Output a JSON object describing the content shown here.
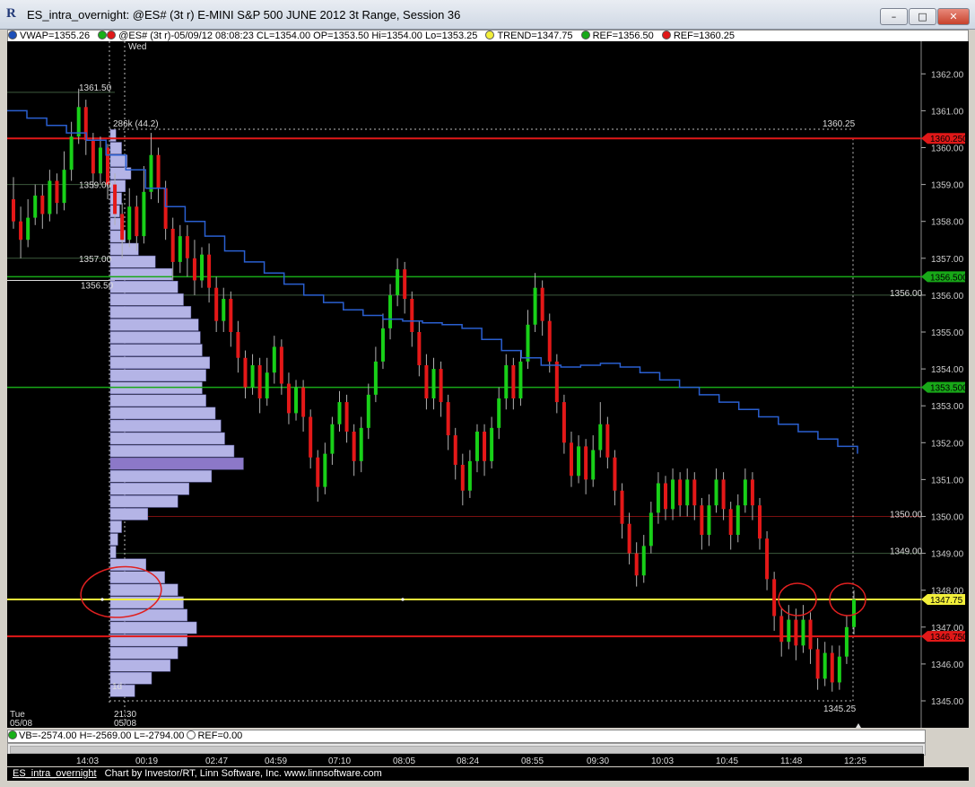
{
  "window": {
    "title": "ES_intra_overnight: @ES# (3t r) E-MINI S&P 500 JUNE 2012 3t Range, Session 36",
    "icon": "R",
    "minimize": "–",
    "maximize": "□",
    "close": "✕"
  },
  "infobar": {
    "vwap": "VWAP=1355.26",
    "quote": "@ES# (3t r)-05/09/12 08:08:23 CL=1354.00 OP=1353.50 Hi=1354.00 Lo=1353.25",
    "trend": "TREND=1347.75",
    "ref1": "REF=1356.50",
    "ref2": "REF=1360.25",
    "colors": {
      "vwap": "#1d4fb8",
      "trend": "#f2ef3a",
      "ref_green": "#18a818",
      "ref_red": "#e01818"
    }
  },
  "mbox": "M",
  "bottombar": {
    "vb": "VB=-2574.00 H=-2569.00 L=-2794.00",
    "ref": "REF=0.00"
  },
  "status": {
    "tab": "ES_intra_overnight",
    "credit": "Chart by Investor/RT, Linn Software, Inc. www.linnsoftware.com"
  },
  "chart_data": {
    "type": "candlestick",
    "ylim": [
      1343.7,
      1362.5
    ],
    "y_ticks": [
      1344,
      1345,
      1346,
      1347,
      1348,
      1349,
      1350,
      1351,
      1352,
      1353,
      1354,
      1355,
      1356,
      1357,
      1358,
      1359,
      1360,
      1361,
      1362
    ],
    "y_tick_labels": [
      "1344.00",
      "1345.00",
      "1346.00",
      "1347.00",
      "1348.00",
      "1349.00",
      "1350.00",
      "1351.00",
      "1352.00",
      "1353.00",
      "1354.00",
      "1355.00",
      "1356.00",
      "1357.00",
      "1358.00",
      "1359.00",
      "1360.00",
      "1361.00",
      "1362.00"
    ],
    "x_labels": [
      "14:03",
      "00:19",
      "02:47",
      "04:59",
      "07:10",
      "08:05",
      "08:24",
      "08:55",
      "09:30",
      "10:03",
      "10:45",
      "11:48",
      "12:25"
    ],
    "session_labels": {
      "left_day": "Tue",
      "left_date": "05/08",
      "mid_time": "21:30",
      "mid_date": "05/08",
      "day_marker": "Wed",
      "profile_tag": "1d"
    },
    "reference_lines": [
      {
        "name": "REF red upper",
        "value": 1360.25,
        "color": "#e01818",
        "tag": "1360.250"
      },
      {
        "name": "REF green",
        "value": 1356.5,
        "color": "#18a818",
        "tag": "1356.500"
      },
      {
        "name": "green level",
        "value": 1353.5,
        "color": "#18a818",
        "tag": "1353.500"
      },
      {
        "name": "TREND",
        "value": 1347.75,
        "color": "#f2ef3a",
        "tag": "1347.75"
      },
      {
        "name": "REF red lower",
        "value": 1346.75,
        "color": "#e01818",
        "tag": "1346.750"
      }
    ],
    "annotations": [
      {
        "text": "1361.50",
        "value": 1361.5
      },
      {
        "text": "1359.00",
        "value": 1359.0
      },
      {
        "text": "1357.00",
        "value": 1357.0
      },
      {
        "text": "1356.50",
        "value": 1356.5
      },
      {
        "text": "286k (44.2)",
        "value": 1360.5
      },
      {
        "text": "1360.25",
        "value": 1360.5
      },
      {
        "text": "1356.00",
        "value": 1356.0
      },
      {
        "text": "1350.00",
        "value": 1350.0
      },
      {
        "text": "1349.00",
        "value": 1349.0
      },
      {
        "text": "1345.25",
        "value": 1345.0
      }
    ],
    "vwap": [
      1361.0,
      1360.8,
      1360.6,
      1360.4,
      1360.2,
      1359.8,
      1359.4,
      1358.9,
      1358.4,
      1358.0,
      1357.6,
      1357.2,
      1356.9,
      1356.6,
      1356.3,
      1356.0,
      1355.8,
      1355.6,
      1355.45,
      1355.35,
      1355.3,
      1355.25,
      1355.2,
      1355.1,
      1354.8,
      1354.5,
      1354.3,
      1354.1,
      1354.05,
      1354.1,
      1354.15,
      1354.05,
      1353.9,
      1353.7,
      1353.5,
      1353.3,
      1353.1,
      1352.9,
      1352.7,
      1352.5,
      1352.3,
      1352.1,
      1351.9,
      1351.7
    ],
    "profile_volume": [
      0.3,
      0.6,
      0.9,
      1.1,
      0.8,
      0.6,
      0.5,
      0.55,
      0.8,
      1.5,
      2.4,
      3.3,
      3.6,
      3.9,
      4.3,
      4.7,
      4.8,
      4.9,
      5.3,
      5.1,
      4.9,
      5.1,
      5.6,
      5.9,
      6.1,
      6.6,
      7.1,
      5.4,
      4.2,
      3.6,
      2.0,
      0.6,
      0.4,
      0.3,
      1.9,
      2.9,
      3.6,
      3.9,
      4.1,
      4.6,
      4.1,
      3.6,
      3.2,
      2.2,
      1.3
    ],
    "candles": [
      [
        1358.6,
        1358.0,
        1359.2,
        1357.8
      ],
      [
        1358.0,
        1357.5,
        1358.4,
        1357.0
      ],
      [
        1357.5,
        1358.1,
        1358.6,
        1357.3
      ],
      [
        1358.1,
        1358.7,
        1359.0,
        1357.9
      ],
      [
        1358.7,
        1358.2,
        1359.0,
        1357.8
      ],
      [
        1358.2,
        1359.1,
        1359.4,
        1358.0
      ],
      [
        1359.1,
        1358.5,
        1359.3,
        1358.2
      ],
      [
        1358.5,
        1359.4,
        1359.9,
        1358.3
      ],
      [
        1359.4,
        1360.3,
        1360.7,
        1359.1
      ],
      [
        1360.3,
        1361.1,
        1361.6,
        1360.1
      ],
      [
        1361.1,
        1360.2,
        1361.3,
        1359.8
      ],
      [
        1360.2,
        1359.3,
        1360.4,
        1358.9
      ],
      [
        1359.3,
        1360.0,
        1360.3,
        1359.0
      ],
      [
        1360.0,
        1359.0,
        1360.1,
        1358.6
      ],
      [
        1359.0,
        1358.2,
        1359.3,
        1357.9
      ],
      [
        1358.2,
        1357.5,
        1358.5,
        1357.0
      ],
      [
        1357.5,
        1358.4,
        1358.9,
        1357.3
      ],
      [
        1358.4,
        1357.6,
        1358.7,
        1357.2
      ],
      [
        1357.6,
        1358.8,
        1359.5,
        1357.4
      ],
      [
        1358.8,
        1359.8,
        1360.4,
        1358.6
      ],
      [
        1359.8,
        1358.9,
        1360.0,
        1358.5
      ],
      [
        1358.9,
        1357.8,
        1359.1,
        1357.5
      ],
      [
        1357.8,
        1356.9,
        1358.1,
        1356.4
      ],
      [
        1356.9,
        1357.6,
        1357.9,
        1356.6
      ],
      [
        1357.6,
        1357.0,
        1357.9,
        1356.5
      ],
      [
        1357.0,
        1356.4,
        1357.5,
        1356.0
      ],
      [
        1356.4,
        1357.1,
        1357.3,
        1356.2
      ],
      [
        1357.1,
        1356.2,
        1357.4,
        1355.8
      ],
      [
        1356.2,
        1355.3,
        1356.5,
        1355.0
      ],
      [
        1355.3,
        1355.9,
        1356.2,
        1355.0
      ],
      [
        1355.9,
        1355.0,
        1356.1,
        1354.6
      ],
      [
        1355.0,
        1354.3,
        1355.3,
        1353.9
      ],
      [
        1354.3,
        1353.5,
        1354.5,
        1353.2
      ],
      [
        1353.5,
        1354.1,
        1354.4,
        1353.3
      ],
      [
        1354.1,
        1353.2,
        1354.3,
        1352.8
      ],
      [
        1353.2,
        1353.9,
        1354.3,
        1353.0
      ],
      [
        1353.9,
        1354.6,
        1354.9,
        1353.6
      ],
      [
        1354.6,
        1353.6,
        1354.8,
        1353.3
      ],
      [
        1353.6,
        1352.8,
        1353.9,
        1352.5
      ],
      [
        1352.8,
        1353.5,
        1353.7,
        1352.6
      ],
      [
        1353.5,
        1352.7,
        1353.7,
        1352.3
      ],
      [
        1352.7,
        1351.6,
        1352.9,
        1351.3
      ],
      [
        1351.6,
        1350.8,
        1351.8,
        1350.4
      ],
      [
        1350.8,
        1351.7,
        1352.0,
        1350.6
      ],
      [
        1351.7,
        1352.5,
        1352.7,
        1351.4
      ],
      [
        1352.5,
        1353.1,
        1353.4,
        1352.3
      ],
      [
        1353.1,
        1352.3,
        1353.3,
        1352.0
      ],
      [
        1352.3,
        1351.5,
        1352.5,
        1351.1
      ],
      [
        1351.5,
        1352.4,
        1352.7,
        1351.2
      ],
      [
        1352.4,
        1353.3,
        1353.6,
        1352.1
      ],
      [
        1353.3,
        1354.2,
        1354.6,
        1353.1
      ],
      [
        1354.2,
        1355.1,
        1355.5,
        1354.0
      ],
      [
        1355.1,
        1356.0,
        1356.3,
        1354.8
      ],
      [
        1356.0,
        1356.7,
        1357.0,
        1355.7
      ],
      [
        1356.7,
        1355.9,
        1356.9,
        1355.5
      ],
      [
        1355.9,
        1355.0,
        1356.1,
        1354.6
      ],
      [
        1355.0,
        1354.1,
        1355.3,
        1353.8
      ],
      [
        1354.1,
        1353.2,
        1354.4,
        1352.9
      ],
      [
        1353.2,
        1354.0,
        1354.3,
        1352.9
      ],
      [
        1354.0,
        1353.1,
        1354.2,
        1352.7
      ],
      [
        1353.1,
        1352.2,
        1353.3,
        1351.8
      ],
      [
        1352.2,
        1351.4,
        1352.4,
        1351.0
      ],
      [
        1351.4,
        1350.7,
        1351.7,
        1350.3
      ],
      [
        1350.7,
        1351.5,
        1351.8,
        1350.5
      ],
      [
        1351.5,
        1352.3,
        1352.5,
        1351.2
      ],
      [
        1352.3,
        1351.5,
        1352.5,
        1351.1
      ],
      [
        1351.5,
        1352.4,
        1352.7,
        1351.3
      ],
      [
        1352.4,
        1353.2,
        1353.5,
        1352.1
      ],
      [
        1353.2,
        1354.1,
        1354.4,
        1352.9
      ],
      [
        1354.1,
        1353.2,
        1354.3,
        1352.9
      ],
      [
        1353.2,
        1354.2,
        1354.5,
        1353.0
      ],
      [
        1354.2,
        1355.2,
        1355.6,
        1354.0
      ],
      [
        1355.2,
        1356.2,
        1356.6,
        1355.0
      ],
      [
        1356.2,
        1355.3,
        1356.4,
        1354.9
      ],
      [
        1355.3,
        1354.2,
        1355.5,
        1353.9
      ],
      [
        1354.2,
        1353.1,
        1354.4,
        1352.8
      ],
      [
        1353.1,
        1352.0,
        1353.3,
        1351.7
      ],
      [
        1352.0,
        1351.1,
        1352.3,
        1350.8
      ],
      [
        1351.1,
        1351.9,
        1352.2,
        1350.9
      ],
      [
        1351.9,
        1351.0,
        1352.1,
        1350.6
      ],
      [
        1351.0,
        1351.8,
        1352.2,
        1350.8
      ],
      [
        1351.8,
        1352.5,
        1353.1,
        1351.6
      ],
      [
        1352.5,
        1351.6,
        1352.7,
        1351.3
      ],
      [
        1351.6,
        1350.7,
        1351.8,
        1350.3
      ],
      [
        1350.7,
        1349.8,
        1350.9,
        1349.4
      ],
      [
        1349.8,
        1349.0,
        1350.1,
        1348.7
      ],
      [
        1349.0,
        1348.4,
        1349.3,
        1348.1
      ],
      [
        1348.4,
        1349.2,
        1349.5,
        1348.2
      ],
      [
        1349.2,
        1350.1,
        1350.4,
        1349.0
      ],
      [
        1350.1,
        1350.9,
        1351.2,
        1349.8
      ],
      [
        1350.9,
        1350.2,
        1351.1,
        1349.9
      ],
      [
        1350.2,
        1351.0,
        1351.3,
        1349.9
      ],
      [
        1351.0,
        1350.3,
        1351.2,
        1350.0
      ],
      [
        1350.3,
        1351.0,
        1351.3,
        1350.0
      ],
      [
        1351.0,
        1350.3,
        1351.2,
        1349.9
      ],
      [
        1350.3,
        1349.5,
        1350.5,
        1349.1
      ],
      [
        1349.5,
        1350.3,
        1350.6,
        1349.2
      ],
      [
        1350.3,
        1351.0,
        1351.3,
        1350.1
      ],
      [
        1351.0,
        1350.2,
        1351.2,
        1349.9
      ],
      [
        1350.2,
        1349.5,
        1350.4,
        1349.1
      ],
      [
        1349.5,
        1350.3,
        1350.6,
        1349.3
      ],
      [
        1350.3,
        1351.0,
        1351.3,
        1350.1
      ],
      [
        1351.0,
        1350.3,
        1351.2,
        1349.9
      ],
      [
        1350.3,
        1349.4,
        1350.5,
        1349.1
      ],
      [
        1349.4,
        1348.3,
        1349.6,
        1348.0
      ],
      [
        1348.3,
        1347.3,
        1348.5,
        1346.9
      ],
      [
        1347.3,
        1346.6,
        1347.5,
        1346.2
      ],
      [
        1346.6,
        1347.2,
        1347.6,
        1346.4
      ],
      [
        1347.2,
        1346.5,
        1347.5,
        1346.1
      ],
      [
        1346.5,
        1347.2,
        1347.6,
        1346.3
      ],
      [
        1347.2,
        1346.4,
        1347.4,
        1346.0
      ],
      [
        1346.4,
        1345.6,
        1346.7,
        1345.3
      ],
      [
        1345.6,
        1346.3,
        1346.6,
        1345.4
      ],
      [
        1346.3,
        1345.5,
        1346.5,
        1345.25
      ],
      [
        1345.5,
        1346.2,
        1346.5,
        1345.3
      ],
      [
        1346.2,
        1347.0,
        1347.3,
        1346.0
      ],
      [
        1347.0,
        1347.75,
        1348.0,
        1346.8
      ]
    ]
  }
}
